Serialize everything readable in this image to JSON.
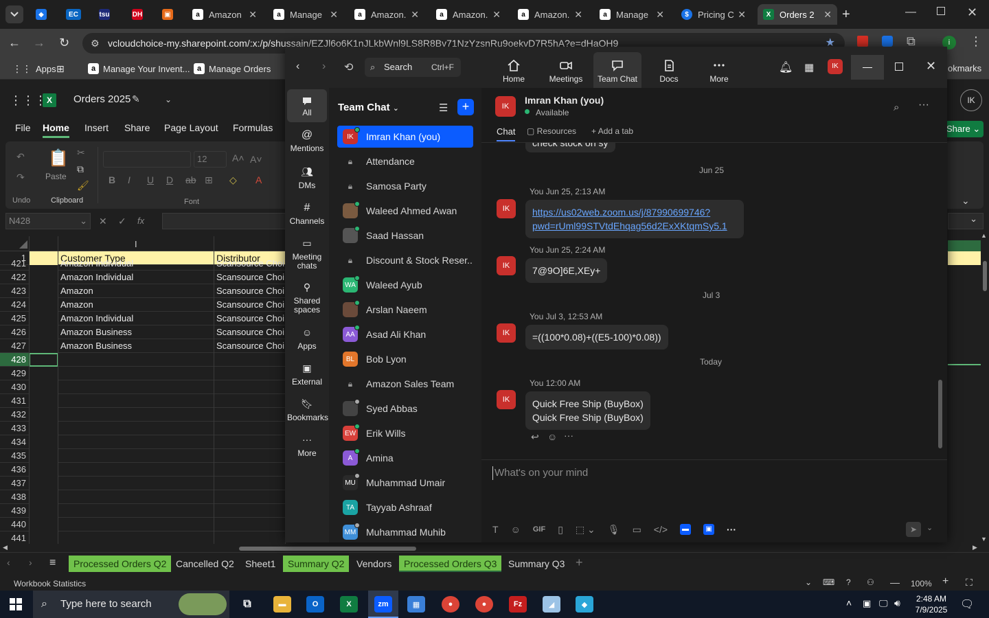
{
  "browser": {
    "tabs": [
      {
        "label": ""
      },
      {
        "label": ""
      },
      {
        "label": ""
      },
      {
        "label": ""
      },
      {
        "label": "Amazon"
      },
      {
        "label": "Manage"
      },
      {
        "label": "Amazon."
      },
      {
        "label": "Amazon."
      },
      {
        "label": "Amazon."
      },
      {
        "label": "Manage"
      },
      {
        "label": "Pricing C"
      },
      {
        "label": "Orders 2"
      }
    ],
    "url": "vcloudchoice-my.sharepoint.com/:x:/p/shussain/EZJl6o6K1nJLkbWnl9LS8R8Bv71NzYzsnRu9oekvD7R5hA?e=dHaOH9",
    "bookmarks": [
      {
        "label": "Apps"
      },
      {
        "label": "Manage Your Invent..."
      },
      {
        "label": "Manage Orders"
      }
    ],
    "bookmarks_right": "okmarks"
  },
  "excel": {
    "title": "Orders 2025",
    "menus": [
      "File",
      "Home",
      "Insert",
      "Share",
      "Page Layout",
      "Formulas"
    ],
    "ribbon": {
      "undo": "Undo",
      "paste": "Paste",
      "clipboard": "Clipboard",
      "font": "Font",
      "font_size": "12"
    },
    "namebox": "N428",
    "share_label": "Share",
    "user_initials": "IK",
    "columns": {
      "col_i": "I",
      "customer_type": "Customer Type",
      "distributor": "Distributor"
    },
    "rows": [
      {
        "num": "1",
        "type": "Customer Type",
        "dist": "Distributor"
      },
      {
        "num": "421",
        "type": "Amazon Individual",
        "dist": "Scansource Choi"
      },
      {
        "num": "422",
        "type": "Amazon Individual",
        "dist": "Scansource Choi"
      },
      {
        "num": "423",
        "type": "Amazon",
        "dist": "Scansource Choi"
      },
      {
        "num": "424",
        "type": "Amazon",
        "dist": "Scansource Choi"
      },
      {
        "num": "425",
        "type": "Amazon Individual",
        "dist": "Scansource Choi"
      },
      {
        "num": "426",
        "type": "Amazon Business",
        "dist": "Scansource Choi"
      },
      {
        "num": "427",
        "type": "Amazon Business",
        "dist": "Scansource Choi"
      },
      {
        "num": "428",
        "type": "",
        "dist": ""
      },
      {
        "num": "429",
        "type": "",
        "dist": ""
      },
      {
        "num": "430",
        "type": "",
        "dist": ""
      },
      {
        "num": "431",
        "type": "",
        "dist": ""
      },
      {
        "num": "432",
        "type": "",
        "dist": ""
      },
      {
        "num": "433",
        "type": "",
        "dist": ""
      },
      {
        "num": "434",
        "type": "",
        "dist": ""
      },
      {
        "num": "435",
        "type": "",
        "dist": ""
      },
      {
        "num": "436",
        "type": "",
        "dist": ""
      },
      {
        "num": "437",
        "type": "",
        "dist": ""
      },
      {
        "num": "438",
        "type": "",
        "dist": ""
      },
      {
        "num": "439",
        "type": "",
        "dist": ""
      },
      {
        "num": "440",
        "type": "",
        "dist": ""
      },
      {
        "num": "441",
        "type": "",
        "dist": ""
      }
    ],
    "sheet_tabs": [
      {
        "label": "Processed Orders Q2",
        "green": true
      },
      {
        "label": "Cancelled Q2",
        "green": false
      },
      {
        "label": "Sheet1",
        "green": false
      },
      {
        "label": "Summary Q2",
        "green": true
      },
      {
        "label": "Vendors",
        "green": false
      },
      {
        "label": "Processed Orders Q3",
        "green": true
      },
      {
        "label": "Summary Q3",
        "green": false
      }
    ],
    "status_left": "Workbook Statistics",
    "zoom_level": "100%"
  },
  "zoom": {
    "search_label": "Search",
    "search_shortcut": "Ctrl+F",
    "nav": [
      {
        "label": "Home"
      },
      {
        "label": "Meetings"
      },
      {
        "label": "Team Chat"
      },
      {
        "label": "Docs"
      },
      {
        "label": "More"
      }
    ],
    "avatar_initials": "IK",
    "sidebar": [
      {
        "label": "All"
      },
      {
        "label": "Mentions"
      },
      {
        "label": "DMs"
      },
      {
        "label": "Channels"
      },
      {
        "label": "Meeting chats"
      },
      {
        "label": "Shared spaces"
      },
      {
        "label": "Apps"
      },
      {
        "label": "External"
      },
      {
        "label": "Bookmarks"
      },
      {
        "label": "More"
      }
    ],
    "list_title": "Team Chat",
    "contacts": [
      {
        "name": "Imran Khan (you)",
        "initials": "IK",
        "color": "#c9302c",
        "status": "#2bb673",
        "selected": true
      },
      {
        "name": "Attendance",
        "initials": "",
        "color": "#3a3a3a",
        "status": "",
        "selected": false
      },
      {
        "name": "Samosa Party",
        "initials": "",
        "color": "#3a3a3a",
        "status": "",
        "selected": false
      },
      {
        "name": "Waleed Ahmed Awan",
        "initials": "",
        "color": "#7a5a40",
        "status": "#2bb673",
        "selected": false
      },
      {
        "name": "Saad Hassan",
        "initials": "",
        "color": "#555555",
        "status": "#2bb673",
        "selected": false
      },
      {
        "name": "Discount & Stock Reser...",
        "initials": "",
        "color": "#3a3a3a",
        "status": "",
        "selected": false
      },
      {
        "name": "Waleed Ayub",
        "initials": "WA",
        "color": "#2bb673",
        "status": "#2bb673",
        "selected": false
      },
      {
        "name": "Arslan Naeem",
        "initials": "",
        "color": "#6a4a3a",
        "status": "#2bb673",
        "selected": false
      },
      {
        "name": "Asad Ali Khan",
        "initials": "AA",
        "color": "#8b5ad6",
        "status": "#2bb673",
        "selected": false
      },
      {
        "name": "Bob Lyon",
        "initials": "BL",
        "color": "#e2762b",
        "status": "",
        "selected": false
      },
      {
        "name": "Amazon Sales Team",
        "initials": "",
        "color": "#3a3a3a",
        "status": "",
        "selected": false
      },
      {
        "name": "Syed Abbas",
        "initials": "",
        "color": "#444444",
        "status": "#aaaaaa",
        "selected": false
      },
      {
        "name": "Erik Wills",
        "initials": "EW",
        "color": "#d8403a",
        "status": "#2bb673",
        "selected": false
      },
      {
        "name": "Amina",
        "initials": "A",
        "color": "#8b5ad6",
        "status": "#2bb673",
        "selected": false
      },
      {
        "name": "Muhammad Umair",
        "initials": "MU",
        "color": "#2a2a2a",
        "status": "#aaaaaa",
        "selected": false
      },
      {
        "name": "Tayyab Ashraaf",
        "initials": "TA",
        "color": "#1aa3a3",
        "status": "",
        "selected": false
      },
      {
        "name": "Muhammad Muhib",
        "initials": "MM",
        "color": "#3f8fd8",
        "status": "#aaaaaa",
        "selected": false
      }
    ],
    "chat": {
      "name": "Imran Khan (you)",
      "status": "Available",
      "tabs": [
        "Chat",
        "Resources",
        "Add a tab"
      ],
      "partial_msg": "check stock on sy",
      "messages": [
        {
          "date": "Jun 25",
          "meta": "You Jun 25, 2:13 AM",
          "lines": [
            "https://us02web.zoom.us/j/87990699746?",
            "pwd=rUml99STVtdEhqag56d2ExXKtqmSy5.1"
          ],
          "link": true
        },
        {
          "date": "",
          "meta": "You Jun 25, 2:24 AM",
          "lines": [
            "7@9O]6E,XEy+"
          ],
          "link": false
        },
        {
          "date": "Jul 3",
          "meta": "You Jul 3, 12:53 AM",
          "lines": [
            "=((100*0.08)+((E5-100)*0.08))"
          ],
          "link": false
        },
        {
          "date": "Today",
          "meta": "You 12:00 AM",
          "lines": [
            "Quick Free Ship (BuyBox)",
            "Quick Free Ship (BuyBox)"
          ],
          "link": false
        }
      ],
      "composer_placeholder": "What's on your mind",
      "composer_gif": "GIF"
    }
  },
  "taskbar": {
    "search_placeholder": "Type here to search",
    "time": "2:48 AM",
    "date": "7/9/2025"
  }
}
